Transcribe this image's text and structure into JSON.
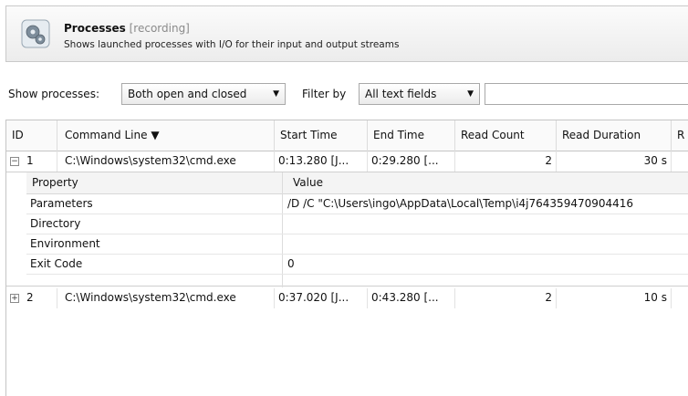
{
  "header": {
    "title": "Processes",
    "status": "[recording]",
    "subtitle": "Shows launched processes with I/O for their input and output streams"
  },
  "filters": {
    "show_label": "Show processes:",
    "show_value": "Both open and closed",
    "filter_label": "Filter by",
    "filter_value": "All text fields",
    "search_value": ""
  },
  "table": {
    "columns": [
      "ID",
      "Command Line ▼",
      "Start Time",
      "End Time",
      "Read Count",
      "Read Duration",
      "R"
    ],
    "rows": [
      {
        "toggle": "−",
        "id": "1",
        "command": "C:\\Windows\\system32\\cmd.exe",
        "start": "0:13.280 [J...",
        "end": "0:29.280 [...",
        "read_count": "2",
        "read_duration": "30 s"
      },
      {
        "toggle": "+",
        "id": "2",
        "command": "C:\\Windows\\system32\\cmd.exe",
        "start": "0:37.020 [J...",
        "end": "0:43.280 [...",
        "read_count": "2",
        "read_duration": "10 s"
      }
    ]
  },
  "detail": {
    "headers": [
      "Property",
      "Value"
    ],
    "rows": [
      {
        "property": "Parameters",
        "value": "/D /C \"C:\\Users\\ingo\\AppData\\Local\\Temp\\i4j764359470904416"
      },
      {
        "property": "Directory",
        "value": ""
      },
      {
        "property": "Environment",
        "value": ""
      },
      {
        "property": "Exit Code",
        "value": "0"
      }
    ]
  }
}
